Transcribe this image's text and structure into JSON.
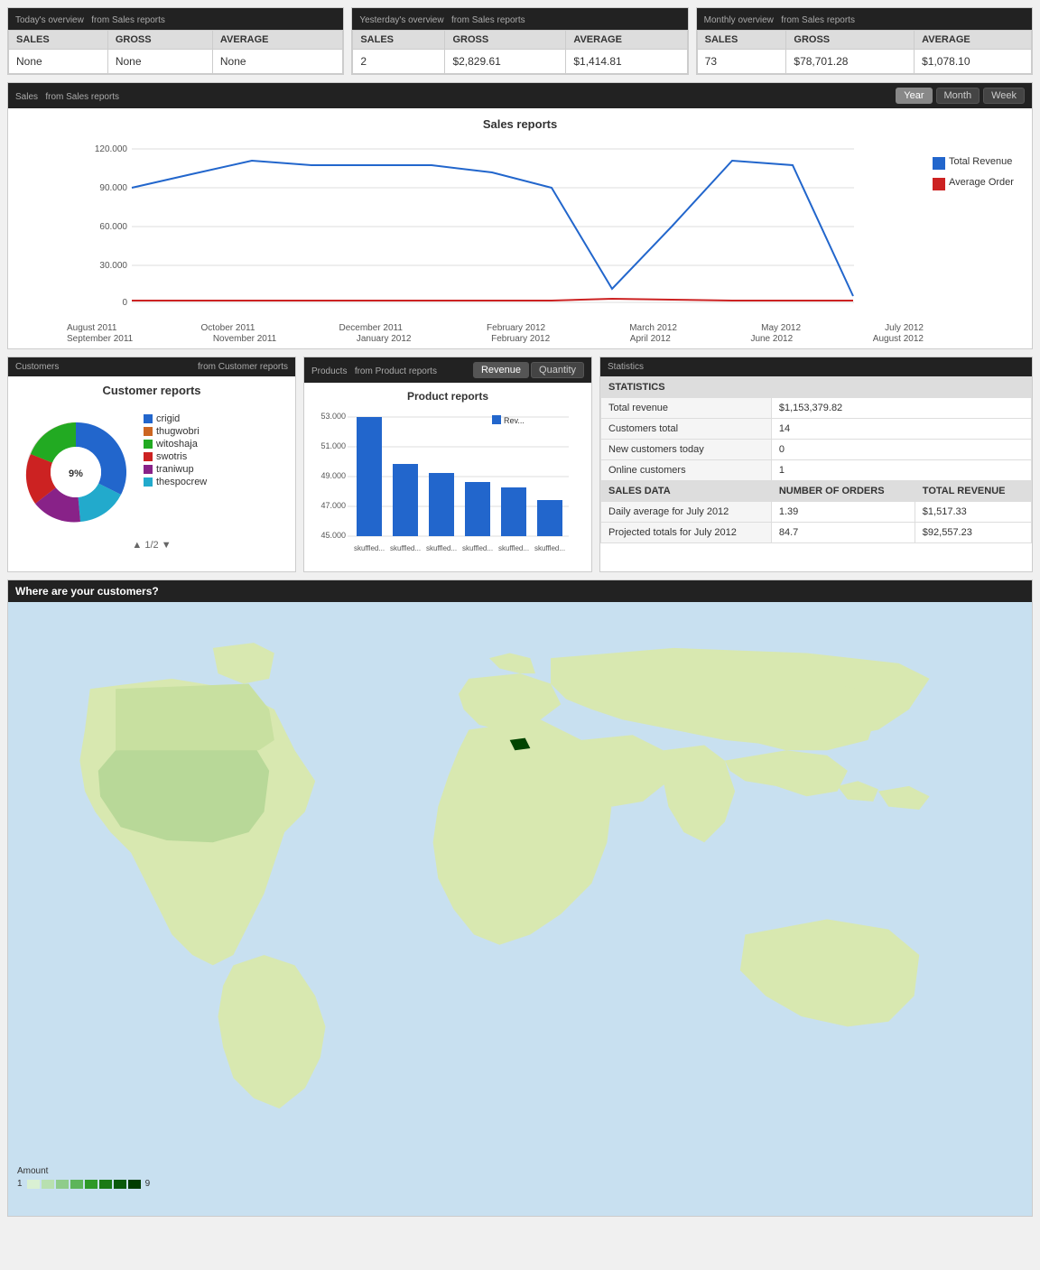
{
  "overviews": [
    {
      "title": "Today's overview",
      "source": "from Sales reports",
      "cols": [
        "SALES",
        "GROSS",
        "AVERAGE"
      ],
      "row": [
        "None",
        "None",
        "None"
      ]
    },
    {
      "title": "Yesterday's overview",
      "source": "from Sales reports",
      "cols": [
        "SALES",
        "GROSS",
        "AVERAGE"
      ],
      "row": [
        "2",
        "$2,829.61",
        "$1,414.81"
      ]
    },
    {
      "title": "Monthly overview",
      "source": "from Sales reports",
      "cols": [
        "SALES",
        "GROSS",
        "AVERAGE"
      ],
      "row": [
        "73",
        "$78,701.28",
        "$1,078.10"
      ]
    }
  ],
  "sales_section": {
    "title": "Sales",
    "source": "from Sales reports",
    "chart_title": "Sales reports",
    "toggles": [
      "Year",
      "Month",
      "Week"
    ],
    "active_toggle": "Year",
    "x_labels_row1": [
      "August 2011",
      "October 2011",
      "December 2011",
      "February 2012",
      "March 2012",
      "May 2012",
      "July 2012"
    ],
    "x_labels_row2": [
      "September 2011",
      "November 2011",
      "January 2012",
      "February 2012",
      "April 2012",
      "June 2012",
      "August 2012"
    ],
    "y_labels": [
      "120.000",
      "90.000",
      "60.000",
      "30.000",
      "0"
    ],
    "legend": [
      {
        "label": "Total Revenue",
        "color": "#2266cc"
      },
      {
        "label": "Average Order",
        "color": "#cc2222"
      }
    ]
  },
  "customers_section": {
    "title": "Customers",
    "source": "from Customer reports",
    "chart_title": "Customer reports",
    "center_label": "9%",
    "legend": [
      {
        "label": "crigid",
        "color": "#2266cc"
      },
      {
        "label": "thugwobri",
        "color": "#cc6622"
      },
      {
        "label": "witoshaja",
        "color": "#22aa22"
      },
      {
        "label": "swotris",
        "color": "#cc2222"
      },
      {
        "label": "traniwup",
        "color": "#882288"
      },
      {
        "label": "thespocrew",
        "color": "#22aacc"
      }
    ],
    "pagination": "1/2"
  },
  "products_section": {
    "title": "Products",
    "source": "from Product reports",
    "chart_title": "Product reports",
    "toggles": [
      "Revenue",
      "Quantity"
    ],
    "active_toggle": "Revenue",
    "y_labels": [
      "53.000",
      "51.000",
      "49.000",
      "47.000",
      "45.000"
    ],
    "bars": [
      {
        "label": "skuffled...",
        "value": 95
      },
      {
        "label": "skuffled...",
        "value": 60
      },
      {
        "label": "skuffled...",
        "value": 55
      },
      {
        "label": "skuffled...",
        "value": 52
      },
      {
        "label": "skuffled...",
        "value": 48
      },
      {
        "label": "skuffled...",
        "value": 30
      }
    ],
    "legend_label": "Rev..."
  },
  "statistics": {
    "title": "Statistics",
    "section_header": "STATISTICS",
    "rows": [
      {
        "label": "Total revenue",
        "value": "$1,153,379.82"
      },
      {
        "label": "Customers total",
        "value": "14"
      },
      {
        "label": "New customers today",
        "value": "0"
      },
      {
        "label": "Online customers",
        "value": "1"
      }
    ],
    "sales_data_header": "SALES DATA",
    "col2_header": "NUMBER OF ORDERS",
    "col3_header": "TOTAL REVENUE",
    "sales_rows": [
      {
        "label": "Daily average for July 2012",
        "col2": "1.39",
        "col3": "$1,517.33"
      },
      {
        "label": "Projected totals for July 2012",
        "col2": "84.7",
        "col3": "$92,557.23"
      }
    ]
  },
  "map_section": {
    "title": "Where are your customers?",
    "legend_label": "Amount",
    "legend_min": "1",
    "legend_max": "9",
    "swatches": [
      "#d9f0d3",
      "#b8e0b0",
      "#8fcc8b",
      "#5db55a",
      "#2e9928",
      "#1a7a15",
      "#0a5a0a",
      "#003d00"
    ]
  }
}
